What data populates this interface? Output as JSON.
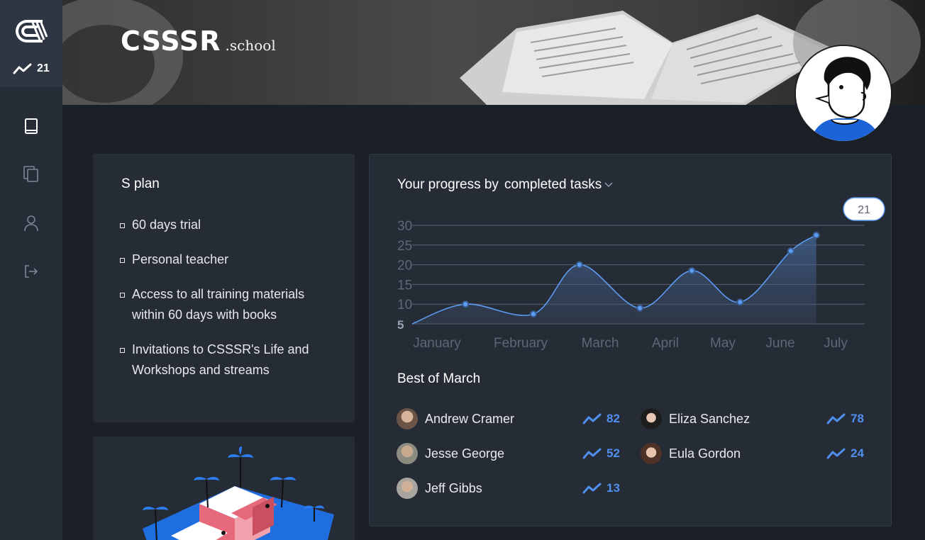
{
  "sidebar": {
    "score": "21",
    "nav": [
      {
        "icon": "book-icon"
      },
      {
        "icon": "copy-icon"
      },
      {
        "icon": "user-icon"
      },
      {
        "icon": "logout-icon"
      }
    ]
  },
  "header": {
    "brand": "CSSSR",
    "brand_suffix": ".school"
  },
  "plan": {
    "title": "S plan",
    "items": [
      "60 days trial",
      "Personal teacher",
      "Access to all training materials within 60 days with books",
      "Invitations to CSSSR's Life and Workshops and streams"
    ]
  },
  "progress": {
    "title_prefix": "Your progress by",
    "metric": "completed tasks",
    "tooltip_value": "21"
  },
  "chart_data": {
    "type": "area",
    "categories": [
      "January",
      "February",
      "March",
      "April",
      "May",
      "June",
      "July"
    ],
    "y_ticks": [
      "30",
      "25",
      "20",
      "15",
      "10",
      "5"
    ],
    "ylim": [
      5,
      30
    ],
    "grid": true,
    "points": [
      {
        "x": 0.0,
        "y": 5
      },
      {
        "x": 0.34,
        "y": 10
      },
      {
        "x": 1.16,
        "y": 7.5
      },
      {
        "x": 1.74,
        "y": 20
      },
      {
        "x": 2.61,
        "y": 9
      },
      {
        "x": 3.46,
        "y": 18.5
      },
      {
        "x": 4.3,
        "y": 10.5
      },
      {
        "x": 5.19,
        "y": 23.5
      },
      {
        "x": 5.65,
        "y": 27.5
      }
    ],
    "highlight_value": 21,
    "color": "#5b9cf5"
  },
  "best": {
    "title": "Best of March",
    "leaders": [
      {
        "name": "Andrew Cramer",
        "score": "82"
      },
      {
        "name": "Eliza Sanchez",
        "score": "78"
      },
      {
        "name": "Jesse George",
        "score": "52"
      },
      {
        "name": "Eula Gordon",
        "score": "24"
      },
      {
        "name": "Jeff Gibbs",
        "score": "13"
      }
    ]
  },
  "colors": {
    "accent": "#4f8ff0",
    "card": "#262c36",
    "background": "#1b1f26"
  }
}
